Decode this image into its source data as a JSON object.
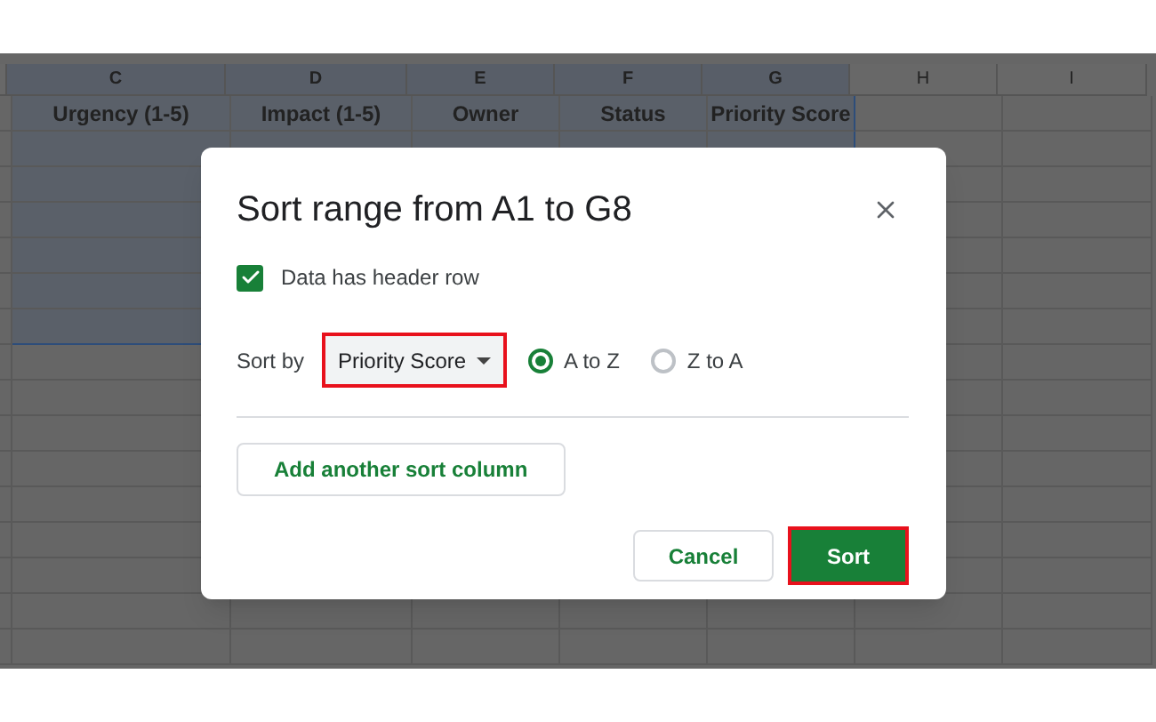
{
  "sheet": {
    "columns": [
      {
        "label": "C",
        "selected": true
      },
      {
        "label": "D",
        "selected": true
      },
      {
        "label": "E",
        "selected": true
      },
      {
        "label": "F",
        "selected": true
      },
      {
        "label": "G",
        "selected": true
      },
      {
        "label": "H",
        "selected": false
      },
      {
        "label": "I",
        "selected": false
      }
    ],
    "rows": [
      [
        "Urgency (1-5)",
        "Impact (1-5)",
        "Owner",
        "Status",
        "Priority Score"
      ]
    ]
  },
  "dialog": {
    "title": "Sort range from A1 to G8",
    "header_row": {
      "label": "Data has header row",
      "checked": true
    },
    "sort_by": {
      "label": "Sort by",
      "value": "Priority Score"
    },
    "orders": [
      {
        "label": "A to Z",
        "selected": true
      },
      {
        "label": "Z to A",
        "selected": false
      }
    ],
    "add_button": "Add another sort column",
    "cancel_button": "Cancel",
    "sort_button": "Sort"
  }
}
